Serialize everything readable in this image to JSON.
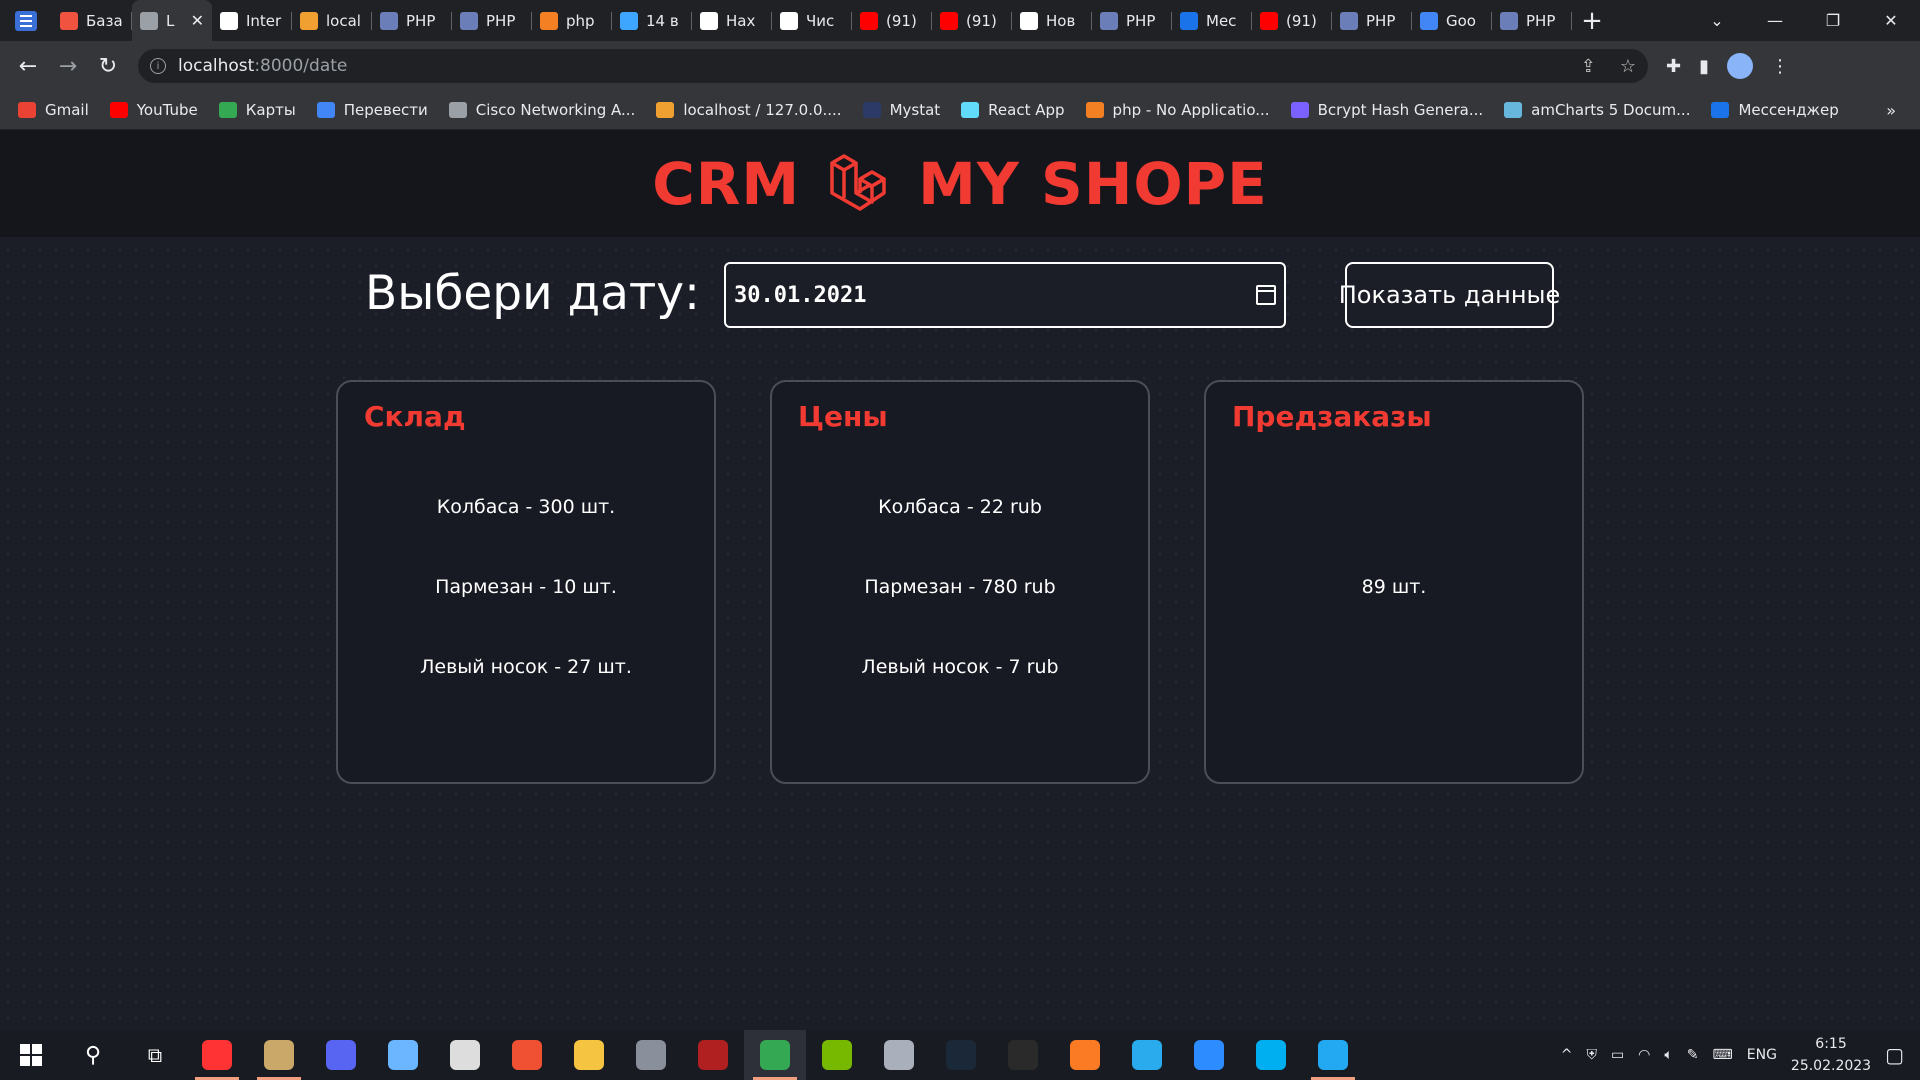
{
  "browser": {
    "tabs": [
      {
        "label": "База",
        "icon": "laravel-icon",
        "color": "#f05340"
      },
      {
        "label": "L",
        "icon": "globe-icon",
        "color": "#9aa0a6",
        "active": true
      },
      {
        "label": "Inter",
        "icon": "github-icon",
        "color": "#ffffff"
      },
      {
        "label": "local",
        "icon": "phpmyadmin-icon",
        "color": "#f0a030"
      },
      {
        "label": "PHP",
        "icon": "php-icon",
        "color": "#6c7eb7"
      },
      {
        "label": "PHP",
        "icon": "php-icon",
        "color": "#6c7eb7"
      },
      {
        "label": "php",
        "icon": "stackoverflow-icon",
        "color": "#f48024"
      },
      {
        "label": "14 в",
        "icon": "app-icon",
        "color": "#3ea6ff"
      },
      {
        "label": "Hax",
        "icon": "habr-icon",
        "color": "#ffffff"
      },
      {
        "label": "Чис",
        "icon": "doc-icon",
        "color": "#ffffff"
      },
      {
        "label": "(91)",
        "icon": "youtube-icon",
        "color": "#ff0000"
      },
      {
        "label": "(91)",
        "icon": "youtube-icon",
        "color": "#ff0000"
      },
      {
        "label": "Нов",
        "icon": "chrome-icon",
        "color": "#ffffff"
      },
      {
        "label": "PHP",
        "icon": "php-icon",
        "color": "#6c7eb7"
      },
      {
        "label": "Мес",
        "icon": "messenger-icon",
        "color": "#1a73e8"
      },
      {
        "label": "(91)",
        "icon": "youtube-icon",
        "color": "#ff0000"
      },
      {
        "label": "PHP",
        "icon": "php-icon",
        "color": "#6c7eb7"
      },
      {
        "label": "Goo",
        "icon": "translate-icon",
        "color": "#4285f4"
      },
      {
        "label": "PHP",
        "icon": "php-icon",
        "color": "#6c7eb7"
      }
    ],
    "url_host": "localhost",
    "url_path": ":8000/date",
    "bookmarks": [
      {
        "label": "Gmail",
        "color": "#ea4335"
      },
      {
        "label": "YouTube",
        "color": "#ff0000"
      },
      {
        "label": "Карты",
        "color": "#34a853"
      },
      {
        "label": "Перевести",
        "color": "#4285f4"
      },
      {
        "label": "Cisco Networking A...",
        "color": "#9aa0a6"
      },
      {
        "label": "localhost / 127.0.0....",
        "color": "#f0a030"
      },
      {
        "label": "Mystat",
        "color": "#2b3a67"
      },
      {
        "label": "React App",
        "color": "#61dafb"
      },
      {
        "label": "php - No Applicatio...",
        "color": "#f48024"
      },
      {
        "label": "Bcrypt Hash Genera...",
        "color": "#7b61ff"
      },
      {
        "label": "amCharts 5 Docum...",
        "color": "#67b7dc"
      },
      {
        "label": "Мессенджер",
        "color": "#1a73e8"
      }
    ],
    "bookmarks_more": "»"
  },
  "app": {
    "brand_left": "CRM",
    "brand_right": "MY SHOPE",
    "brand_color": "#f03a32",
    "date_label": "Выбери дату:",
    "date_value": "30.01.2021",
    "show_button": "Показать данные",
    "cards": {
      "warehouse": {
        "title": "Склад",
        "lines": [
          "Колбаса - 300 шт.",
          "Пармезан - 10 шт.",
          "Левый носок - 27 шт."
        ]
      },
      "prices": {
        "title": "Цены",
        "lines": [
          "Колбаса - 22 rub",
          "Пармезан - 780 rub",
          "Левый носок - 7 rub"
        ]
      },
      "preorders": {
        "title": "Предзаказы",
        "lines": [
          "89 шт."
        ]
      }
    }
  },
  "taskbar": {
    "apps": [
      {
        "name": "yandex-browser-icon",
        "color": "#ff3333",
        "running": true
      },
      {
        "name": "paint-icon",
        "color": "#c9a86a",
        "running": true
      },
      {
        "name": "discord-icon",
        "color": "#5865f2"
      },
      {
        "name": "paint3d-icon",
        "color": "#6bb6ff"
      },
      {
        "name": "obs-icon",
        "color": "#dddddd"
      },
      {
        "name": "git-icon",
        "color": "#f05133"
      },
      {
        "name": "file-explorer-icon",
        "color": "#f5c542"
      },
      {
        "name": "calculator-icon",
        "color": "#8a8f9c"
      },
      {
        "name": "game-icon",
        "color": "#b02020"
      },
      {
        "name": "chrome-icon",
        "color": "#34a853",
        "running": true,
        "active": true
      },
      {
        "name": "nvidia-icon",
        "color": "#76b900"
      },
      {
        "name": "app-icon",
        "color": "#aab0bb"
      },
      {
        "name": "steam-icon",
        "color": "#1b2838"
      },
      {
        "name": "epic-games-icon",
        "color": "#2a2a2a"
      },
      {
        "name": "xampp-icon",
        "color": "#fb7a24"
      },
      {
        "name": "telegram-icon",
        "color": "#2aabee"
      },
      {
        "name": "zoom-icon",
        "color": "#2d8cff"
      },
      {
        "name": "skype-icon",
        "color": "#00aff0"
      },
      {
        "name": "vscode-icon",
        "color": "#23a9f2",
        "running": true
      }
    ],
    "lang": "ENG",
    "time": "6:15",
    "date": "25.02.2023"
  }
}
